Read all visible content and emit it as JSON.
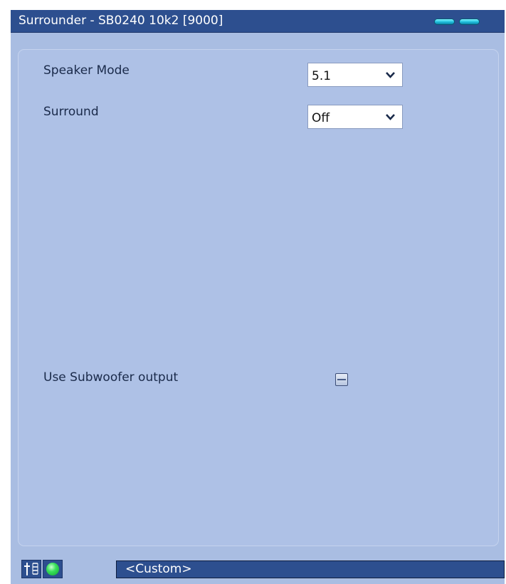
{
  "window": {
    "title": "Surrounder - SB0240 10k2 [9000]"
  },
  "settings": {
    "speaker_mode": {
      "label": "Speaker Mode",
      "value": "5.1"
    },
    "surround": {
      "label": "Surround",
      "value": "Off"
    },
    "subwoofer": {
      "label": "Use Subwoofer output",
      "checked": false
    }
  },
  "statusbar": {
    "preset": "<Custom>"
  },
  "icons": {
    "minimize": "minimize-icon",
    "close": "close-icon",
    "mixer": "mixer-icon",
    "status_led": "status-led-icon",
    "dropdown": "chevron-down-icon"
  },
  "colors": {
    "titlebar": "#2d4f8f",
    "background": "#a9bde2",
    "led": "#39e05a"
  }
}
